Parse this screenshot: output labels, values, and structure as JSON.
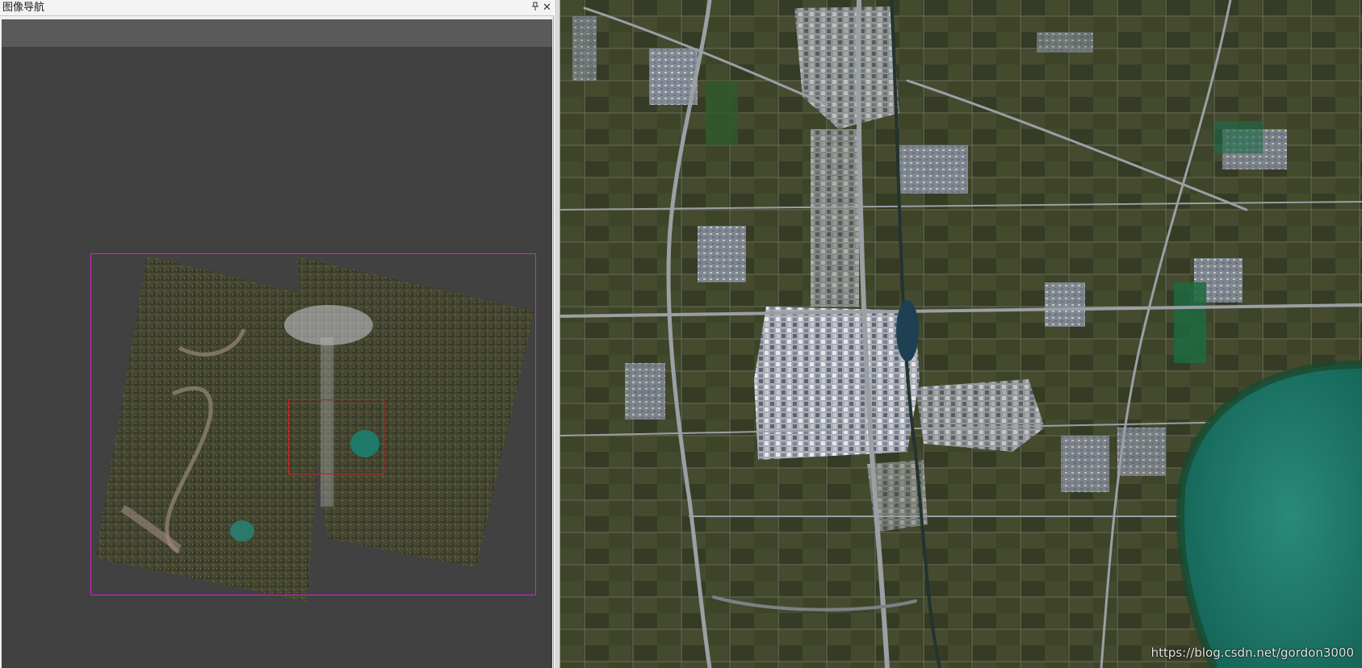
{
  "nav_panel": {
    "title": "图像导航",
    "pin_icon_glyph": "🖈",
    "close_icon_glyph": "✕"
  },
  "colors": {
    "pane_background": "#414141",
    "toolbar_background": "#5a5a5a",
    "image_extent_frame": "#d025d0",
    "current_view_frame": "#d01e1e",
    "farmland": "#3b4228",
    "urban": "#c9cdd6",
    "water": "#1f7a6a"
  },
  "main_view": {
    "watermark": "https://blog.csdn.net/gordon3000"
  }
}
